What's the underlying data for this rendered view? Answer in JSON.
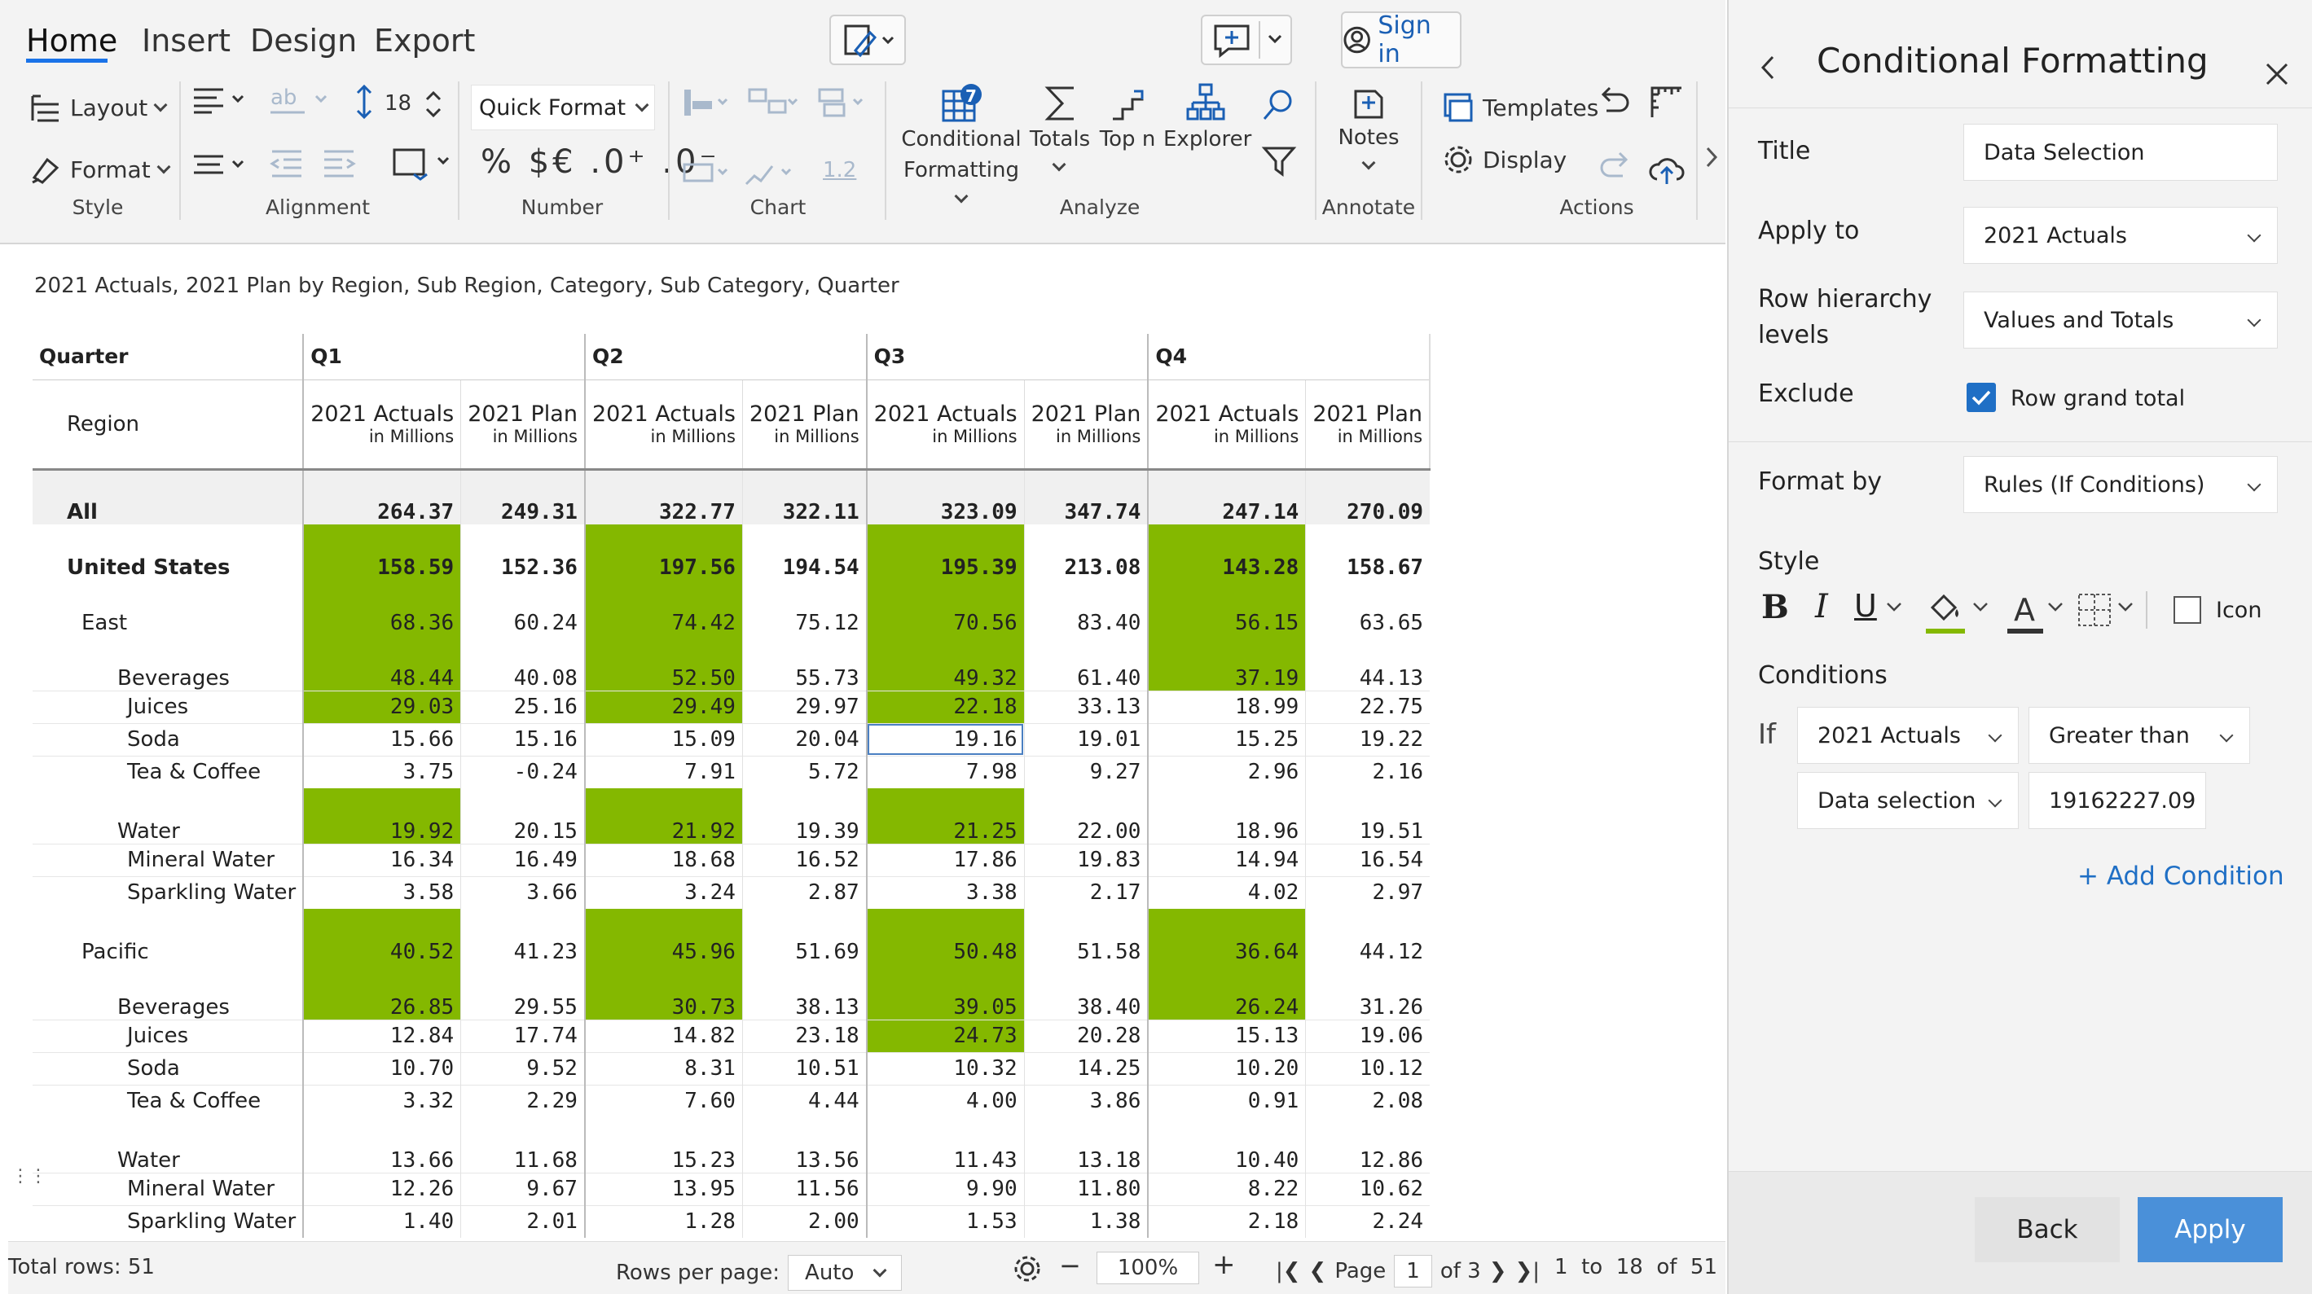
{
  "tabs": [
    "Home",
    "Insert",
    "Design",
    "Export"
  ],
  "signin_label": "Sign in",
  "ribbon": {
    "layout_label": "Layout",
    "format_label": "Format",
    "style_group": "Style",
    "font_size": "18",
    "alignment_group": "Alignment",
    "quick_format_label": "Quick Format",
    "number_format_symbols": "% $€ .0⁺ .0⁻",
    "number_group": "Number",
    "chart_value": "1.2",
    "chart_group": "Chart",
    "cf_badge": "7",
    "cf_label_1": "Conditional",
    "cf_label_2": "Formatting",
    "totals_label": "Totals",
    "topn_label": "Top n",
    "explorer_label": "Explorer",
    "analyze_group": "Analyze",
    "notes_label": "Notes",
    "annotate_group": "Annotate",
    "templates_label": "Templates",
    "display_label": "Display",
    "actions_group": "Actions"
  },
  "report": {
    "subtitle": "2021 Actuals, 2021 Plan by Region, Sub Region, Category, Sub Category, Quarter",
    "quarter_header": "Quarter",
    "region_header": "Region",
    "quarters": [
      "Q1",
      "Q2",
      "Q3",
      "Q4"
    ],
    "measure_actual": "2021 Actuals",
    "measure_plan": "2021 Plan",
    "unit": "in Millions",
    "rows": [
      {
        "label": "All",
        "indent": 0,
        "bold": true,
        "gap": true,
        "values": [
          "264.37",
          "249.31",
          "322.77",
          "322.11",
          "323.09",
          "347.74",
          "247.14",
          "270.09"
        ],
        "green": [
          false,
          false,
          false,
          false,
          false,
          false,
          false,
          false
        ]
      },
      {
        "label": "United States",
        "indent": 0,
        "bold": true,
        "gap": true,
        "values": [
          "158.59",
          "152.36",
          "197.56",
          "194.54",
          "195.39",
          "213.08",
          "143.28",
          "158.67"
        ],
        "green": [
          true,
          false,
          true,
          false,
          true,
          false,
          true,
          false
        ]
      },
      {
        "label": "East",
        "indent": 1,
        "bold": false,
        "gap": true,
        "values": [
          "68.36",
          "60.24",
          "74.42",
          "75.12",
          "70.56",
          "83.40",
          "56.15",
          "63.65"
        ],
        "green": [
          true,
          false,
          true,
          false,
          true,
          false,
          true,
          false
        ]
      },
      {
        "label": "Beverages",
        "indent": 2,
        "bold": false,
        "gap": true,
        "values": [
          "48.44",
          "40.08",
          "52.50",
          "55.73",
          "49.32",
          "61.40",
          "37.19",
          "44.13"
        ],
        "green": [
          true,
          false,
          true,
          false,
          true,
          false,
          true,
          false
        ]
      },
      {
        "label": "Juices",
        "indent": 3,
        "bold": false,
        "gap": false,
        "values": [
          "29.03",
          "25.16",
          "29.49",
          "29.97",
          "22.18",
          "33.13",
          "18.99",
          "22.75"
        ],
        "green": [
          true,
          false,
          true,
          false,
          true,
          false,
          false,
          false
        ]
      },
      {
        "label": "Soda",
        "indent": 3,
        "bold": false,
        "gap": false,
        "values": [
          "15.66",
          "15.16",
          "15.09",
          "20.04",
          "19.16",
          "19.01",
          "15.25",
          "19.22"
        ],
        "green": [
          false,
          false,
          false,
          false,
          false,
          false,
          false,
          false
        ],
        "selected": 4
      },
      {
        "label": "Tea & Coffee",
        "indent": 3,
        "bold": false,
        "gap": false,
        "values": [
          "3.75",
          "-0.24",
          "7.91",
          "5.72",
          "7.98",
          "9.27",
          "2.96",
          "2.16"
        ],
        "green": [
          false,
          false,
          false,
          false,
          false,
          false,
          false,
          false
        ]
      },
      {
        "label": "Water",
        "indent": 2,
        "bold": false,
        "gap": true,
        "values": [
          "19.92",
          "20.15",
          "21.92",
          "19.39",
          "21.25",
          "22.00",
          "18.96",
          "19.51"
        ],
        "green": [
          true,
          false,
          true,
          false,
          true,
          false,
          false,
          false
        ]
      },
      {
        "label": "Mineral Water",
        "indent": 3,
        "bold": false,
        "gap": false,
        "values": [
          "16.34",
          "16.49",
          "18.68",
          "16.52",
          "17.86",
          "19.83",
          "14.94",
          "16.54"
        ],
        "green": [
          false,
          false,
          false,
          false,
          false,
          false,
          false,
          false
        ]
      },
      {
        "label": "Sparkling Water",
        "indent": 3,
        "bold": false,
        "gap": false,
        "values": [
          "3.58",
          "3.66",
          "3.24",
          "2.87",
          "3.38",
          "2.17",
          "4.02",
          "2.97"
        ],
        "green": [
          false,
          false,
          false,
          false,
          false,
          false,
          false,
          false
        ]
      },
      {
        "label": "Pacific",
        "indent": 1,
        "bold": false,
        "gap": true,
        "values": [
          "40.52",
          "41.23",
          "45.96",
          "51.69",
          "50.48",
          "51.58",
          "36.64",
          "44.12"
        ],
        "green": [
          true,
          false,
          true,
          false,
          true,
          false,
          true,
          false
        ]
      },
      {
        "label": "Beverages",
        "indent": 2,
        "bold": false,
        "gap": true,
        "values": [
          "26.85",
          "29.55",
          "30.73",
          "38.13",
          "39.05",
          "38.40",
          "26.24",
          "31.26"
        ],
        "green": [
          true,
          false,
          true,
          false,
          true,
          false,
          true,
          false
        ]
      },
      {
        "label": "Juices",
        "indent": 3,
        "bold": false,
        "gap": false,
        "values": [
          "12.84",
          "17.74",
          "14.82",
          "23.18",
          "24.73",
          "20.28",
          "15.13",
          "19.06"
        ],
        "green": [
          false,
          false,
          false,
          false,
          true,
          false,
          false,
          false
        ]
      },
      {
        "label": "Soda",
        "indent": 3,
        "bold": false,
        "gap": false,
        "values": [
          "10.70",
          "9.52",
          "8.31",
          "10.51",
          "10.32",
          "14.25",
          "10.20",
          "10.12"
        ],
        "green": [
          false,
          false,
          false,
          false,
          false,
          false,
          false,
          false
        ]
      },
      {
        "label": "Tea & Coffee",
        "indent": 3,
        "bold": false,
        "gap": false,
        "values": [
          "3.32",
          "2.29",
          "7.60",
          "4.44",
          "4.00",
          "3.86",
          "0.91",
          "2.08"
        ],
        "green": [
          false,
          false,
          false,
          false,
          false,
          false,
          false,
          false
        ]
      },
      {
        "label": "Water",
        "indent": 2,
        "bold": false,
        "gap": true,
        "values": [
          "13.66",
          "11.68",
          "15.23",
          "13.56",
          "11.43",
          "13.18",
          "10.40",
          "12.86"
        ],
        "green": [
          false,
          false,
          false,
          false,
          false,
          false,
          false,
          false
        ]
      },
      {
        "label": "Mineral Water",
        "indent": 3,
        "bold": false,
        "gap": false,
        "values": [
          "12.26",
          "9.67",
          "13.95",
          "11.56",
          "9.90",
          "11.80",
          "8.22",
          "10.62"
        ],
        "green": [
          false,
          false,
          false,
          false,
          false,
          false,
          false,
          false
        ]
      },
      {
        "label": "Sparkling Water",
        "indent": 3,
        "bold": false,
        "gap": false,
        "values": [
          "1.40",
          "2.01",
          "1.28",
          "2.00",
          "1.53",
          "1.38",
          "2.18",
          "2.24"
        ],
        "green": [
          false,
          false,
          false,
          false,
          false,
          false,
          false,
          false
        ]
      }
    ]
  },
  "status": {
    "total_rows": "Total rows: 51",
    "rows_per_page_label": "Rows per page:",
    "rows_per_page_value": "Auto",
    "zoom": "100%",
    "page_label": "Page",
    "page_value": "1",
    "page_of": "of 3",
    "range": "1  to  18  of  51"
  },
  "panel": {
    "title": "Conditional Formatting",
    "title_label": "Title",
    "title_value": "Data Selection",
    "apply_to_label": "Apply to",
    "apply_to_value": "2021 Actuals",
    "row_levels_label_1": "Row hierarchy",
    "row_levels_label_2": "levels",
    "row_levels_value": "Values and Totals",
    "exclude_label": "Exclude",
    "exclude_option": "Row grand total",
    "format_by_label": "Format by",
    "format_by_value": "Rules (If Conditions)",
    "style_label": "Style",
    "icon_label": "Icon",
    "conditions_label": "Conditions",
    "if_label": "If",
    "cond_field": "2021 Actuals",
    "cond_operator": "Greater than",
    "cond_source": "Data selection",
    "cond_value": "19162227.09",
    "add_condition": "+ Add Condition",
    "back_label": "Back",
    "apply_label": "Apply",
    "accent": "#4a90d9",
    "highlight": "#84b800"
  }
}
